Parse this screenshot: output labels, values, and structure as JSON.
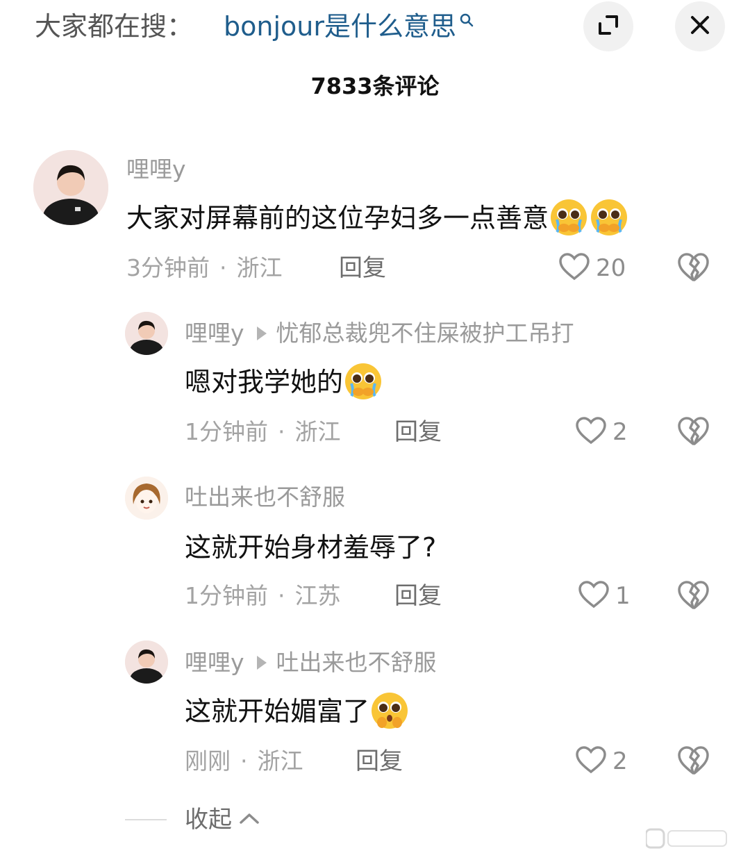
{
  "topbar": {
    "search_prefix": "大家都在搜：",
    "search_query": "bonjour是什么意思",
    "search_icon": "search-icon",
    "expand_icon": "expand-icon",
    "close_icon": "close-icon"
  },
  "header": {
    "comment_count": "7833条评论"
  },
  "comments": [
    {
      "username": "哩哩y",
      "reply_to": "",
      "text": "大家对屏幕前的这位孕妇多一点善意",
      "emojis": [
        "crying-pleading-emoji",
        "crying-pleading-emoji"
      ],
      "time": "3分钟前",
      "location": "浙江",
      "reply_label": "回复",
      "likes": "20"
    },
    {
      "username": "哩哩y",
      "reply_to": "忧郁总裁兜不住屎被护工吊打",
      "text": "嗯对我学她的",
      "emojis": [
        "crying-pleading-emoji"
      ],
      "time": "1分钟前",
      "location": "浙江",
      "reply_label": "回复",
      "likes": "2"
    },
    {
      "username": "吐出来也不舒服",
      "reply_to": "",
      "text": "这就开始身材羞辱了?",
      "emojis": [],
      "time": "1分钟前",
      "location": "江苏",
      "reply_label": "回复",
      "likes": "1"
    },
    {
      "username": "哩哩y",
      "reply_to": "吐出来也不舒服",
      "text": "这就开始媚富了",
      "emojis": [
        "pleading-emoji"
      ],
      "time": "刚刚",
      "location": "浙江",
      "reply_label": "回复",
      "likes": "2"
    }
  ],
  "footer": {
    "collapse_label": "收起"
  },
  "colors": {
    "query_link": "#1f5d8c",
    "muted_text": "#9a9a9a",
    "button_bg": "#f1f1f1"
  }
}
